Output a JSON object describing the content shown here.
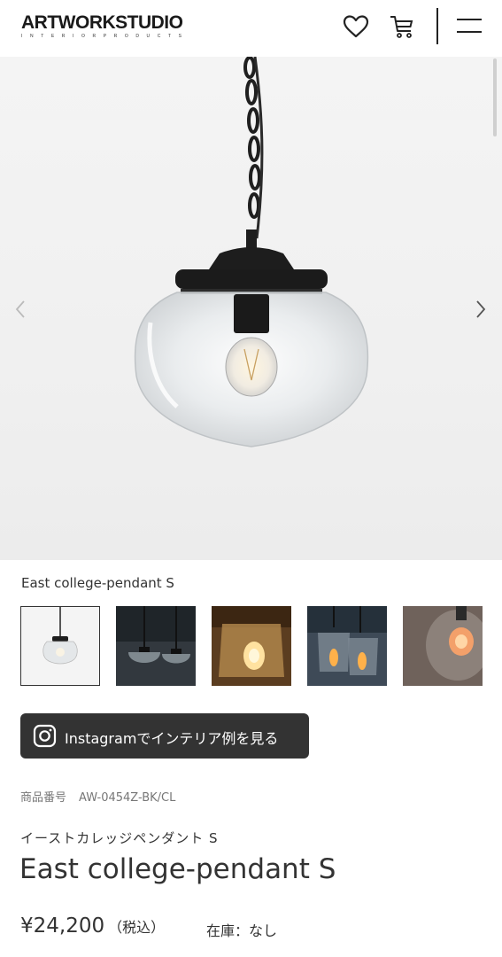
{
  "header": {
    "logo_main": "ARTWORKSTUDIO",
    "logo_sub": "INTERIORPRODUCTS",
    "icons": [
      "heart-icon",
      "cart-icon",
      "menu-icon"
    ]
  },
  "gallery": {
    "caption": "East college-pendant S",
    "thumbnail_count": 5,
    "selected_index": 0
  },
  "instagram_button": {
    "label": "Instagramでインテリア例を見る",
    "icon": "instagram-icon"
  },
  "product": {
    "sku_label": "商品番号",
    "sku": "AW-0454Z-BK/CL",
    "kana_name": "イーストカレッジペンダント S",
    "title": "East college-pendant S",
    "price": "¥24,200",
    "tax_note": "（税込）",
    "stock": "在庫：なし"
  },
  "colors": {
    "button_bg": "#333333",
    "text": "#333333",
    "hero_bg": "#f2f2f2"
  }
}
